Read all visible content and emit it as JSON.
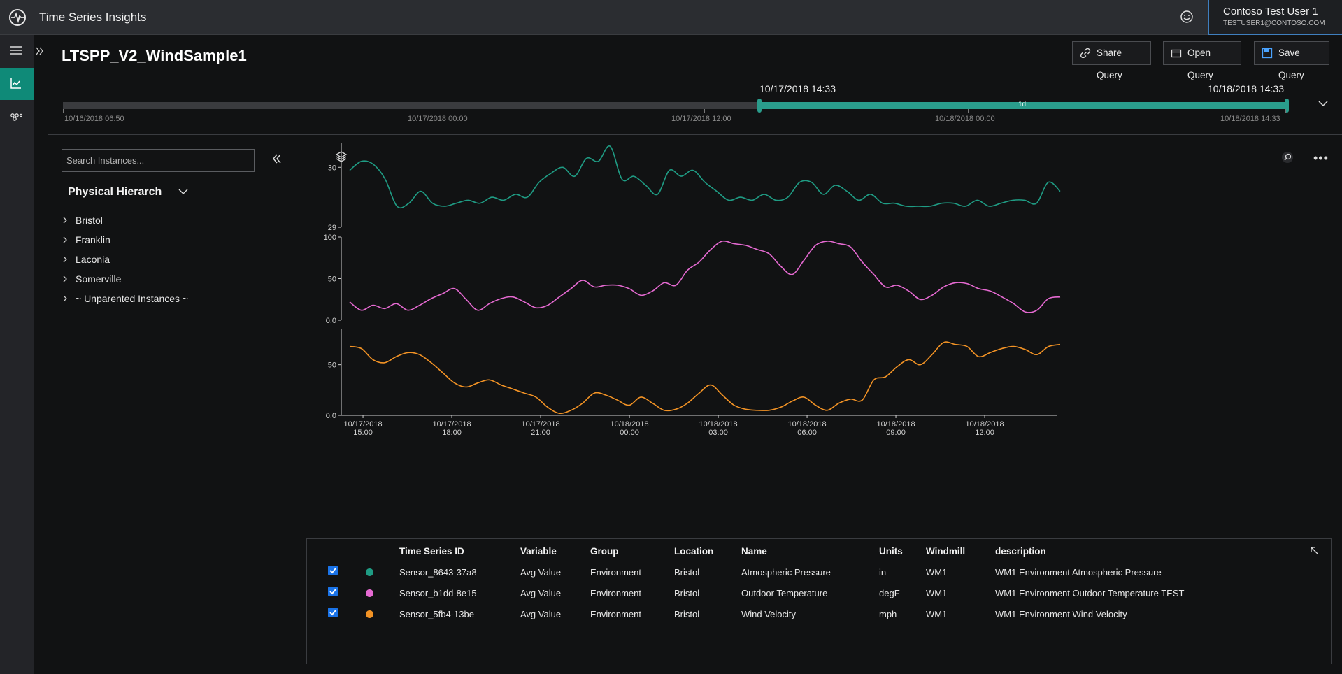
{
  "app": {
    "title": "Time Series Insights",
    "user_name": "Contoso Test User 1",
    "user_email": "TESTUSER1@CONTOSO.COM"
  },
  "query": {
    "title": "LTSPP_V2_WindSample1",
    "buttons": {
      "share": "Share Query",
      "open": "Open Query",
      "save": "Save Query"
    }
  },
  "timebar": {
    "start_label": "10/17/2018 14:33",
    "end_label": "10/18/2018 14:33",
    "span_label": "1d",
    "ticks": [
      "10/16/2018 06:50",
      "10/17/2018 00:00",
      "10/17/2018 12:00",
      "10/18/2018 00:00",
      "10/18/2018 14:33"
    ]
  },
  "sidebar": {
    "search_placeholder": "Search Instances...",
    "hierarchy_title": "Physical Hierarch",
    "items": [
      {
        "label": "Bristol"
      },
      {
        "label": "Franklin"
      },
      {
        "label": "Laconia"
      },
      {
        "label": "Somerville"
      },
      {
        "label": "~ Unparented Instances ~"
      }
    ]
  },
  "chart_data": {
    "type": "line",
    "x_labels": [
      [
        "10/17/2018",
        "15:00"
      ],
      [
        "10/17/2018",
        "18:00"
      ],
      [
        "10/17/2018",
        "21:00"
      ],
      [
        "10/18/2018",
        "00:00"
      ],
      [
        "10/18/2018",
        "03:00"
      ],
      [
        "10/18/2018",
        "06:00"
      ],
      [
        "10/18/2018",
        "09:00"
      ],
      [
        "10/18/2018",
        "12:00"
      ]
    ],
    "x_start_hours": 14.55,
    "x_end_hours": 38.55,
    "series": [
      {
        "name": "Sensor_8643-37a8",
        "color": "#1f9c84",
        "yticks": [
          "30",
          "29"
        ],
        "ylim": [
          29,
          30.4
        ],
        "values": [
          29.95,
          30.1,
          30.05,
          29.8,
          29.35,
          29.4,
          29.6,
          29.4,
          29.35,
          29.4,
          29.45,
          29.4,
          29.5,
          29.45,
          29.55,
          29.5,
          29.75,
          29.9,
          30.0,
          29.85,
          30.15,
          30.1,
          30.35,
          29.8,
          29.85,
          29.7,
          29.55,
          29.95,
          29.85,
          29.95,
          29.75,
          29.6,
          29.45,
          29.5,
          29.45,
          29.55,
          29.45,
          29.5,
          29.75,
          29.75,
          29.55,
          29.7,
          29.6,
          29.45,
          29.55,
          29.4,
          29.4,
          29.35,
          29.35,
          29.35,
          29.4,
          29.4,
          29.35,
          29.45,
          29.35,
          29.4,
          29.45,
          29.45,
          29.4,
          29.75,
          29.6
        ]
      },
      {
        "name": "Sensor_b1dd-8e15",
        "color": "#e66ad2",
        "yticks": [
          "100",
          "50",
          "0.0"
        ],
        "ylim": [
          0,
          100
        ],
        "values": [
          22,
          12,
          18,
          14,
          20,
          12,
          18,
          26,
          32,
          38,
          25,
          12,
          20,
          26,
          28,
          22,
          15,
          18,
          28,
          38,
          48,
          40,
          42,
          42,
          38,
          30,
          35,
          45,
          42,
          60,
          70,
          85,
          95,
          92,
          90,
          85,
          80,
          65,
          55,
          72,
          90,
          95,
          92,
          88,
          70,
          55,
          40,
          42,
          35,
          25,
          30,
          40,
          45,
          44,
          38,
          35,
          28,
          20,
          10,
          12,
          26,
          28
        ]
      },
      {
        "name": "Sensor_5fb4-13be",
        "color": "#f39325",
        "yticks": [
          "50",
          "0.0"
        ],
        "ylim": [
          0,
          85
        ],
        "values": [
          68,
          66,
          55,
          52,
          58,
          62,
          60,
          52,
          42,
          32,
          28,
          32,
          35,
          30,
          26,
          22,
          18,
          8,
          2,
          5,
          12,
          22,
          20,
          15,
          10,
          18,
          12,
          5,
          6,
          12,
          22,
          30,
          20,
          10,
          6,
          5,
          5,
          8,
          14,
          18,
          10,
          5,
          12,
          16,
          15,
          35,
          38,
          48,
          55,
          50,
          60,
          72,
          70,
          68,
          58,
          62,
          66,
          68,
          65,
          60,
          68,
          70
        ]
      }
    ]
  },
  "legend": {
    "headers": [
      "Time Series ID",
      "Variable",
      "Group",
      "Location",
      "Name",
      "Units",
      "Windmill",
      "description"
    ],
    "rows": [
      {
        "color": "#1f9c84",
        "id": "Sensor_8643-37a8",
        "variable": "Avg Value",
        "group": "Environment",
        "location": "Bristol",
        "name": "Atmospheric Pressure",
        "units": "in",
        "windmill": "WM1",
        "description": "WM1 Environment Atmospheric Pressure"
      },
      {
        "color": "#e66ad2",
        "id": "Sensor_b1dd-8e15",
        "variable": "Avg Value",
        "group": "Environment",
        "location": "Bristol",
        "name": "Outdoor Temperature",
        "units": "degF",
        "windmill": "WM1",
        "description": "WM1 Environment Outdoor Temperature TEST"
      },
      {
        "color": "#f39325",
        "id": "Sensor_5fb4-13be",
        "variable": "Avg Value",
        "group": "Environment",
        "location": "Bristol",
        "name": "Wind Velocity",
        "units": "mph",
        "windmill": "WM1",
        "description": "WM1 Environment Wind Velocity"
      }
    ]
  }
}
